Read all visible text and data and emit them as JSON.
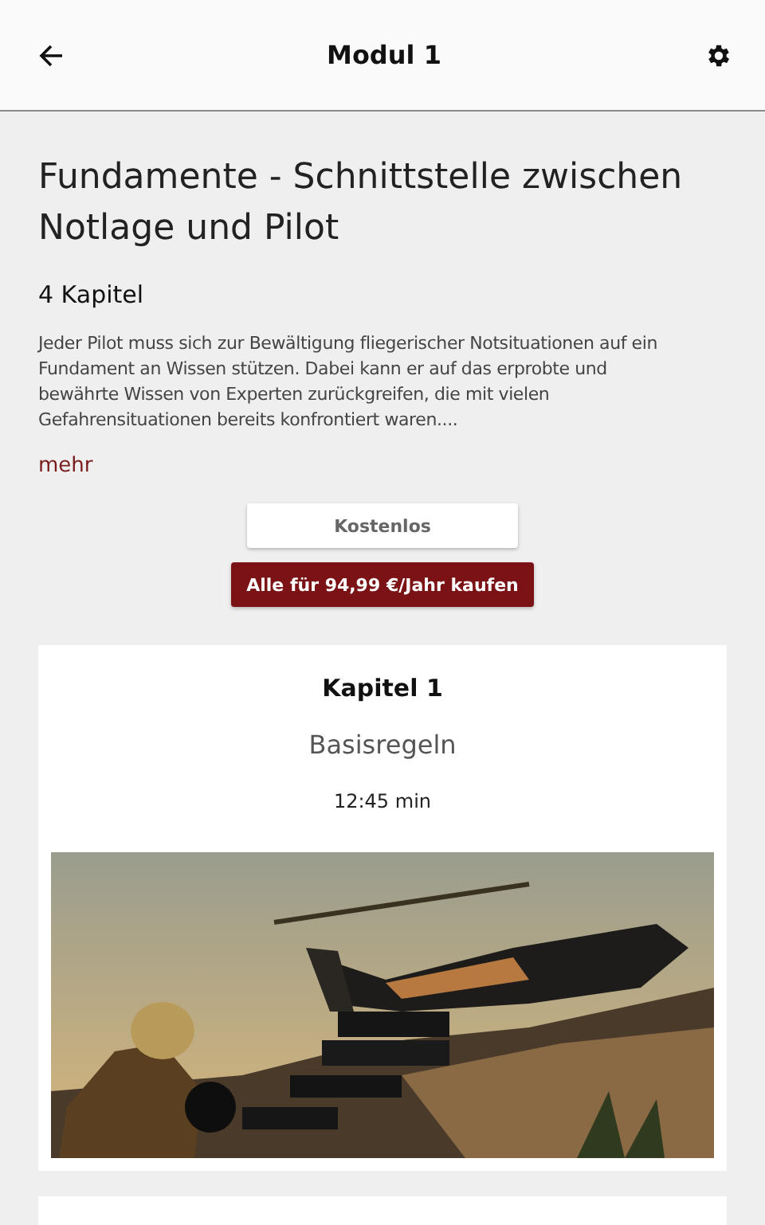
{
  "app_bar": {
    "title": "Modul 1"
  },
  "module": {
    "title": "Fundamente - Schnittstelle zwischen Notlage und Pilot",
    "chapter_count": "4 Kapitel",
    "description": "Jeder Pilot muss sich zur Bewältigung fliegerischer Notsituationen auf ein Fundament an Wissen stützen. Dabei kann er auf das erprobte und bewährte Wissen von Experten zurückgreifen, die mit vielen Gefahrensituationen bereits konfrontiert waren....",
    "more_link": "mehr"
  },
  "buttons": [
    {
      "label": "Kostenlos",
      "kind": "secondary"
    },
    {
      "label": "Alle für 94,99 €/Jahr kaufen",
      "kind": "primary"
    }
  ],
  "chapters": [
    {
      "heading": "Kapitel 1",
      "name": "Basisregeln",
      "duration": "12:45 min"
    }
  ]
}
